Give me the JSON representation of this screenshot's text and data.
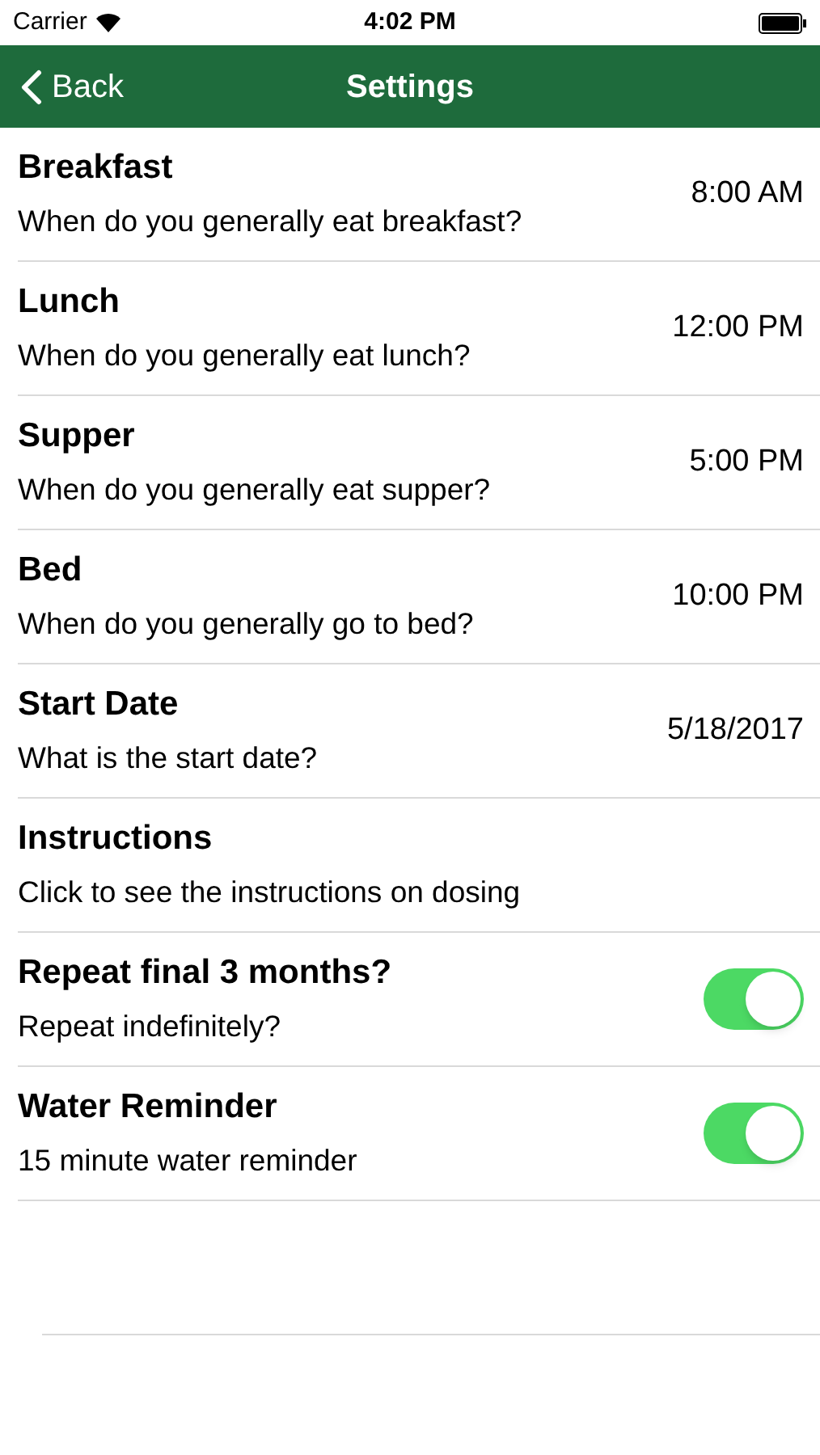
{
  "status_bar": {
    "carrier": "Carrier",
    "time": "4:02 PM"
  },
  "nav": {
    "back": "Back",
    "title": "Settings"
  },
  "rows": [
    {
      "kind": "value",
      "title": "Breakfast",
      "subtitle": "When do you generally eat breakfast?",
      "value": "8:00 AM"
    },
    {
      "kind": "value",
      "title": "Lunch",
      "subtitle": "When do you generally eat lunch?",
      "value": "12:00 PM"
    },
    {
      "kind": "value",
      "title": "Supper",
      "subtitle": "When do you generally eat supper?",
      "value": "5:00 PM"
    },
    {
      "kind": "value",
      "title": "Bed",
      "subtitle": "When do you generally go to bed?",
      "value": "10:00 PM"
    },
    {
      "kind": "value",
      "title": "Start Date",
      "subtitle": "What is the start date?",
      "value": "5/18/2017"
    },
    {
      "kind": "plain",
      "title": "Instructions",
      "subtitle": "Click to see the instructions on dosing"
    },
    {
      "kind": "toggle",
      "title": "Repeat final 3 months?",
      "subtitle": "Repeat indefinitely?",
      "on": true
    },
    {
      "kind": "toggle",
      "title": "Water Reminder",
      "subtitle": "15 minute water reminder",
      "on": true
    }
  ]
}
